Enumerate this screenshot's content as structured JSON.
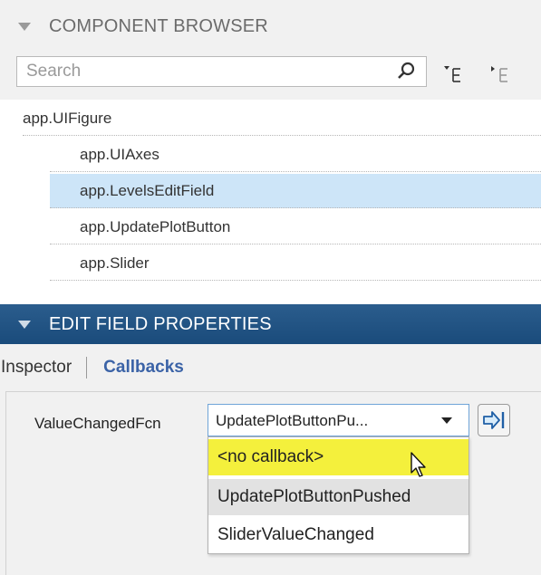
{
  "component_browser": {
    "title": "COMPONENT BROWSER",
    "search_placeholder": "Search",
    "tree": [
      {
        "label": "app.UIFigure",
        "level": 0,
        "selected": false
      },
      {
        "label": "app.UIAxes",
        "level": 1,
        "selected": false
      },
      {
        "label": "app.LevelsEditField",
        "level": 1,
        "selected": true
      },
      {
        "label": "app.UpdatePlotButton",
        "level": 1,
        "selected": false
      },
      {
        "label": "app.Slider",
        "level": 1,
        "selected": false
      }
    ]
  },
  "properties": {
    "title": "EDIT FIELD PROPERTIES",
    "tabs": {
      "inspector": "Inspector",
      "callbacks": "Callbacks",
      "active": "Callbacks"
    },
    "callback_label": "ValueChangedFcn",
    "callback_value": "UpdatePlotButtonPu...",
    "options": [
      "<no callback>",
      "UpdatePlotButtonPushed",
      "SliderValueChanged"
    ]
  },
  "colors": {
    "header_bar": "#1c4f80",
    "selected_row": "#cde5f8",
    "highlight_option": "#f4f03c",
    "callbacks_tab": "#3b63a7"
  },
  "icons": [
    "collapse-triangle-icon",
    "search-icon",
    "expand-all-icon",
    "collapse-all-icon",
    "go-to-callback-icon",
    "mouse-pointer-icon"
  ]
}
